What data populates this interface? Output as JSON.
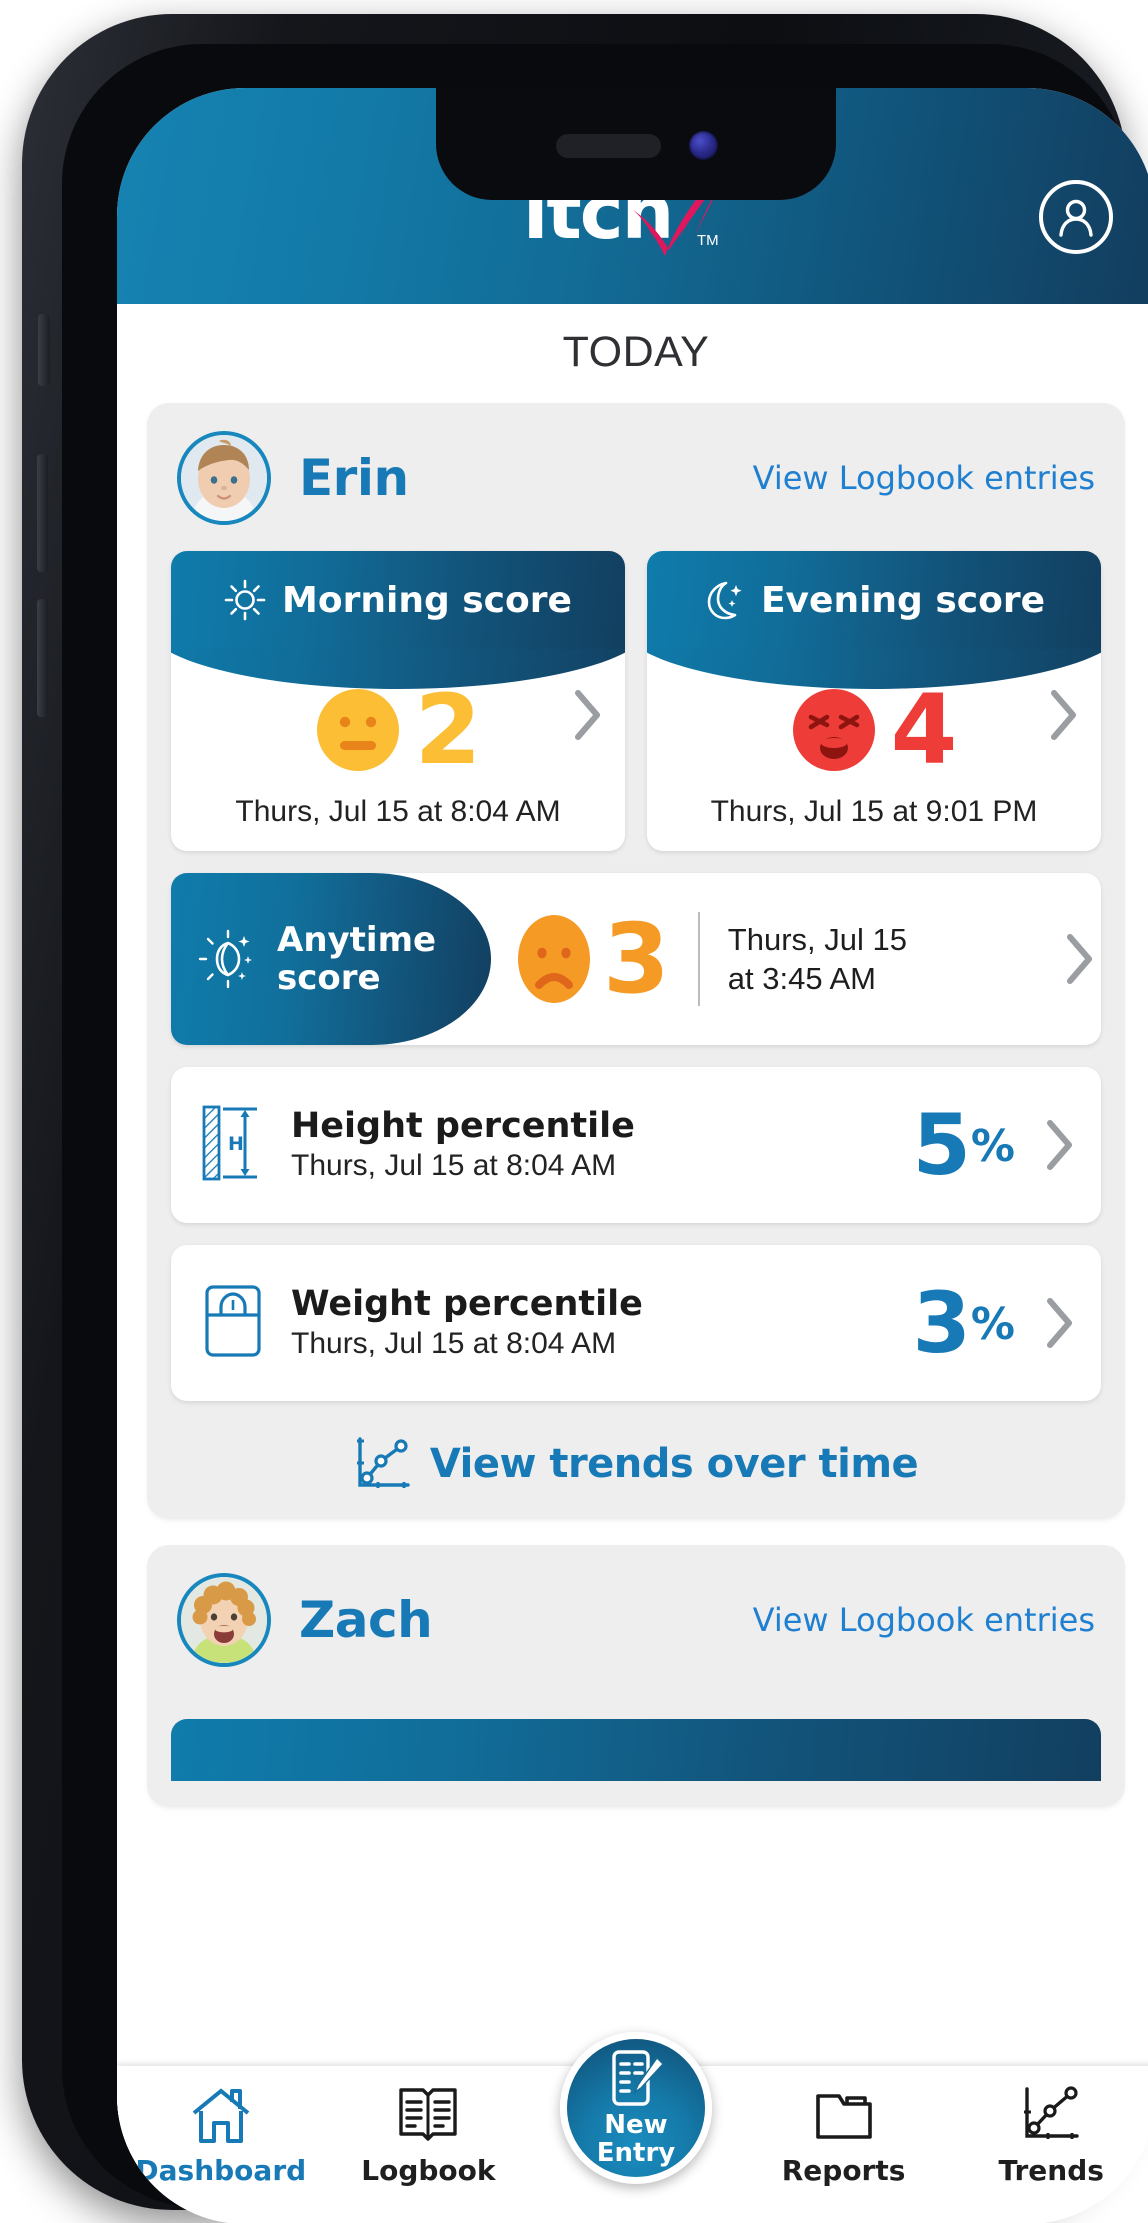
{
  "app": {
    "logo_text": "itch",
    "logo_tm": "TM",
    "brand_blue": "#12557c",
    "brand_blue_light": "#1683b2",
    "brand_pink": "#e0175d"
  },
  "header": {
    "profile_icon": "user-circle-icon",
    "page_title": "TODAY"
  },
  "children": [
    {
      "name": "Erin",
      "logbook_link": "View Logbook entries",
      "avatar": "child-photo-erin",
      "scores": [
        {
          "key": "morning",
          "title": "Morning score",
          "icon": "sun-icon",
          "value": "2",
          "face": "neutral-face-icon",
          "color": "#FBBE35",
          "timestamp": "Thurs, Jul 15 at 8:04 AM"
        },
        {
          "key": "evening",
          "title": "Evening score",
          "icon": "moon-stars-icon",
          "value": "4",
          "face": "distressed-face-icon",
          "color": "#EE3D38",
          "timestamp": "Thurs, Jul 15 at 9:01 PM"
        }
      ],
      "anytime": {
        "title_line1": "Anytime",
        "title_line2": "score",
        "icon": "sun-moon-sparkle-icon",
        "value": "3",
        "face": "sad-face-icon",
        "color": "#F59A24",
        "timestamp_line1": "Thurs, Jul 15",
        "timestamp_line2": "at 3:45 AM"
      },
      "percentiles": [
        {
          "key": "height",
          "icon": "height-measure-icon",
          "label": "Height percentile",
          "timestamp": "Thurs, Jul 15 at 8:04 AM",
          "value": "5",
          "unit": "%"
        },
        {
          "key": "weight",
          "icon": "weight-scale-icon",
          "label": "Weight percentile",
          "timestamp": "Thurs, Jul 15 at 8:04 AM",
          "value": "3",
          "unit": "%"
        }
      ],
      "trends_link": "View trends over time",
      "trends_icon": "line-chart-icon"
    },
    {
      "name": "Zach",
      "logbook_link": "View Logbook entries",
      "avatar": "child-photo-zach"
    }
  ],
  "nav": {
    "items": [
      {
        "key": "dashboard",
        "label": "Dashboard",
        "icon": "home-icon",
        "active": true
      },
      {
        "key": "logbook",
        "label": "Logbook",
        "icon": "open-book-icon",
        "active": false
      },
      {
        "key": "reports",
        "label": "Reports",
        "icon": "folder-icon",
        "active": false
      },
      {
        "key": "trends",
        "label": "Trends",
        "icon": "line-chart-icon",
        "active": false
      }
    ],
    "fab": {
      "label_line1": "New",
      "label_line2": "Entry",
      "icon": "document-pencil-icon"
    }
  }
}
